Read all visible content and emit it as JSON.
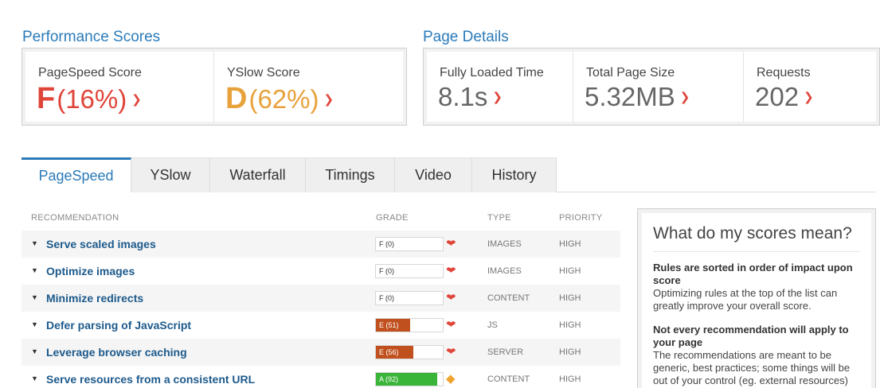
{
  "performance": {
    "title": "Performance Scores",
    "pagespeed": {
      "label": "PageSpeed Score",
      "grade": "F",
      "percent": "(16%)",
      "color": "#e0453a"
    },
    "yslow": {
      "label": "YSlow Score",
      "grade": "D",
      "percent": "(62%)",
      "color": "#e8a23c"
    }
  },
  "details": {
    "title": "Page Details",
    "fully_loaded": {
      "label": "Fully Loaded Time",
      "value": "8.1s"
    },
    "page_size": {
      "label": "Total Page Size",
      "value": "5.32MB"
    },
    "requests": {
      "label": "Requests",
      "value": "202"
    }
  },
  "tabs": [
    {
      "label": "PageSpeed",
      "active": true
    },
    {
      "label": "YSlow"
    },
    {
      "label": "Waterfall"
    },
    {
      "label": "Timings"
    },
    {
      "label": "Video"
    },
    {
      "label": "History"
    }
  ],
  "table": {
    "columns": {
      "recommendation": "RECOMMENDATION",
      "grade": "GRADE",
      "type": "TYPE",
      "priority": "PRIORITY"
    },
    "rows": [
      {
        "name": "Serve scaled images",
        "grade": "F (0)",
        "score": 0,
        "type": "IMAGES",
        "priority": "HIGH",
        "trend": "down"
      },
      {
        "name": "Optimize images",
        "grade": "F (0)",
        "score": 0,
        "type": "IMAGES",
        "priority": "HIGH",
        "trend": "down"
      },
      {
        "name": "Minimize redirects",
        "grade": "F (0)",
        "score": 0,
        "type": "CONTENT",
        "priority": "HIGH",
        "trend": "down"
      },
      {
        "name": "Defer parsing of JavaScript",
        "grade": "E (51)",
        "score": 51,
        "type": "JS",
        "priority": "HIGH",
        "trend": "down"
      },
      {
        "name": "Leverage browser caching",
        "grade": "E (56)",
        "score": 56,
        "type": "SERVER",
        "priority": "HIGH",
        "trend": "down"
      },
      {
        "name": "Serve resources from a consistent URL",
        "grade": "A (92)",
        "score": 92,
        "type": "CONTENT",
        "priority": "HIGH",
        "trend": "neutral"
      }
    ]
  },
  "info": {
    "title": "What do my scores mean?",
    "sections": [
      {
        "heading": "Rules are sorted in order of impact upon score",
        "body": "Optimizing rules at the top of the list can greatly improve your overall score."
      },
      {
        "heading": "Not every recommendation will apply to your page",
        "body": "The recommendations are meant to be generic, best practices; some things will be out of your control (eg. external resources) or may not apply to your page."
      }
    ]
  },
  "colors": {
    "accent": "#2b7bb9",
    "grade_f": "#e0453a",
    "grade_e": "#c1501f",
    "grade_a": "#3ab53a",
    "trend_down": "#e0453a",
    "trend_neutral": "#f0a32f"
  },
  "icons": {
    "trend_down": "chevron-down-icon",
    "trend_neutral": "diamond-icon",
    "expand": "triangle-down-icon"
  }
}
